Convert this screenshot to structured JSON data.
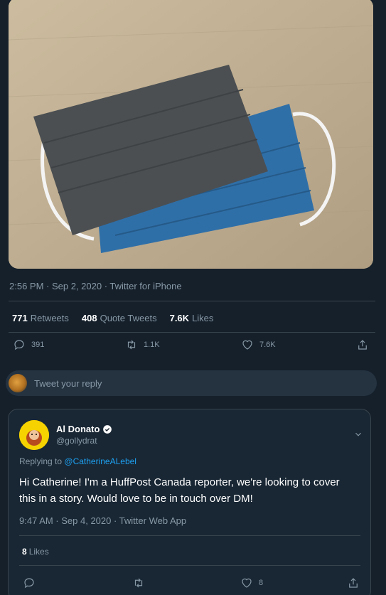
{
  "tweet": {
    "meta_text": "2:56 PM · Sep 2, 2020 · Twitter for iPhone",
    "stats": {
      "retweets_count": "771",
      "retweets_label": "Retweets",
      "quotes_count": "408",
      "quotes_label": "Quote Tweets",
      "likes_count": "7.6K",
      "likes_label": "Likes"
    },
    "actions": {
      "reply_count": "391",
      "retweet_count": "1.1K",
      "like_count": "7.6K"
    }
  },
  "reply_box": {
    "placeholder": "Tweet your reply"
  },
  "reply": {
    "author_name": "Al Donato",
    "author_handle": "@gollydrat",
    "replying_prefix": "Replying to",
    "replying_to": "@CatherineALebel",
    "body": "Hi Catherine! I'm a HuffPost Canada reporter, we're looking to cover this in a story. Would love to be in touch over DM!",
    "meta_text": "9:47 AM · Sep 4, 2020 · Twitter Web App",
    "likes_count": "8",
    "likes_label": "Likes",
    "action_like_count": "8"
  },
  "colors": {
    "background": "#15202b",
    "card": "#192734",
    "accent": "#1da1f2",
    "muted": "#8899a6"
  }
}
